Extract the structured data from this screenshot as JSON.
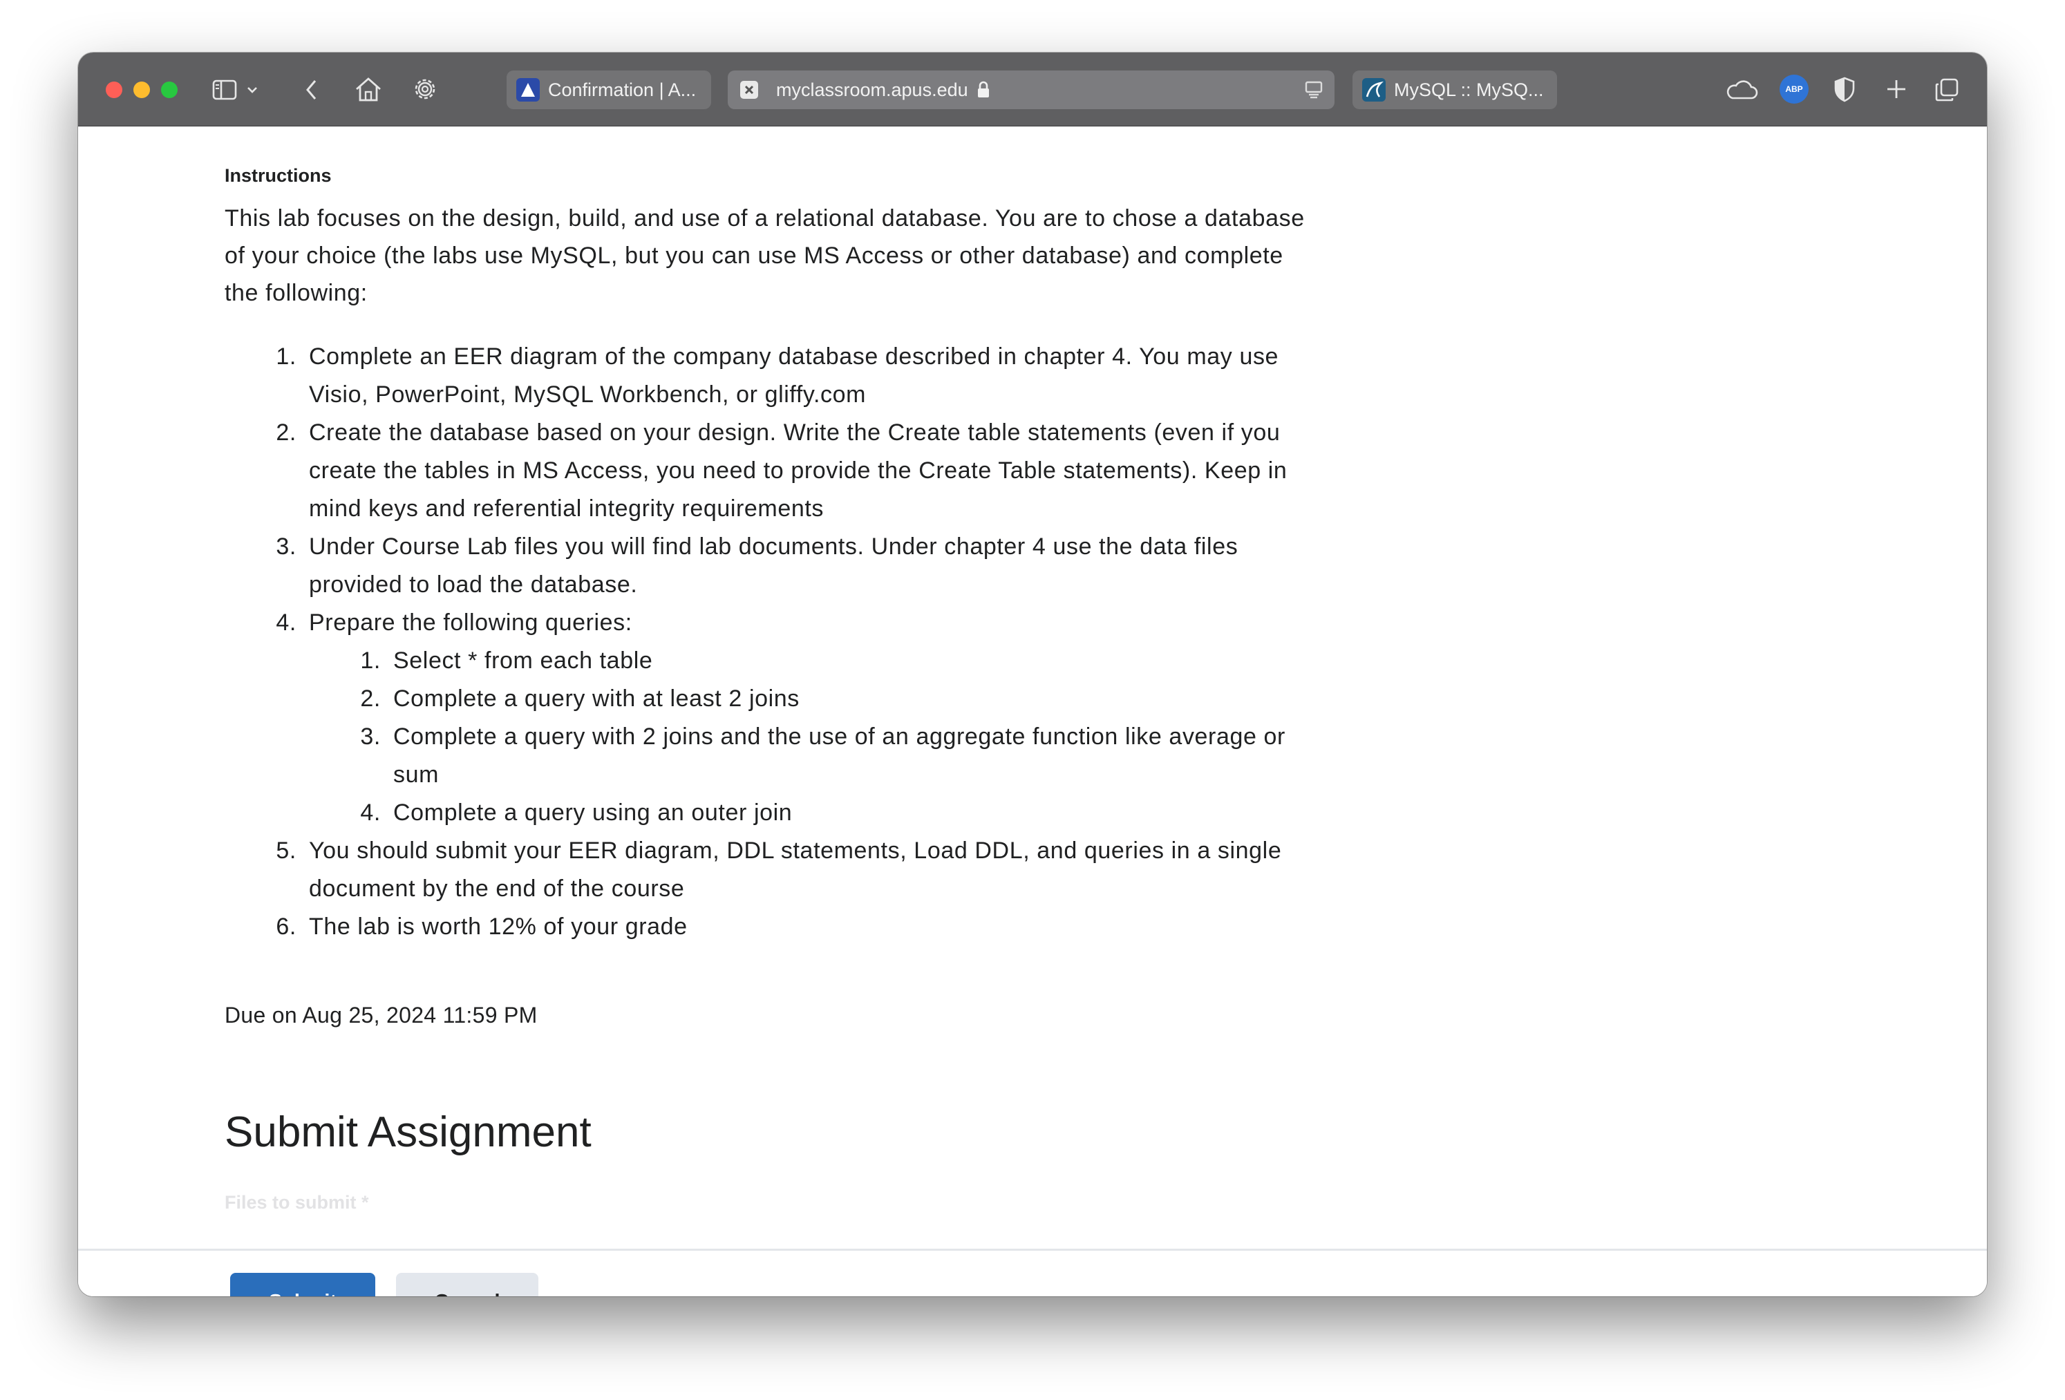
{
  "browser": {
    "tabs": [
      {
        "title": "Confirmation | A...",
        "favicon": "apus-icon",
        "active": false
      },
      {
        "title": "myclassroom.apus.edu",
        "favicon": "x-icon",
        "active": true,
        "lock": true
      },
      {
        "title": "MySQL :: MySQ...",
        "favicon": "mysql-icon",
        "active": false
      }
    ],
    "toolbar_icons": [
      "sidebar-icon",
      "chevron-down-icon",
      "back-icon",
      "home-icon",
      "gear-icon",
      "reader-icon",
      "cloud-icon",
      "abp-icon",
      "shield-icon",
      "plus-icon",
      "tabs-overview-icon"
    ],
    "abp_label": "ABP"
  },
  "assignment": {
    "instructions_label": "Instructions",
    "intro": "This lab focuses on the design, build, and use of a relational database. You are to chose a database of your choice (the labs use MySQL, but you can use MS Access or other database) and complete the following:",
    "steps": [
      "Complete an EER diagram of the company database described in chapter 4. You may use Visio, PowerPoint, MySQL Workbench, or gliffy.com",
      "Create the database based on your design. Write the Create table statements (even if you create the tables in MS Access, you need to provide the Create Table statements). Keep in mind keys and referential integrity requirements",
      "Under Course Lab files you will find lab documents. Under chapter 4 use the data files provided to load the database.",
      "Prepare the following queries:",
      "You should submit your EER diagram, DDL statements, Load DDL, and queries in a single document by the end of the course",
      "The lab is worth 12% of your grade"
    ],
    "queries": [
      "Select * from each table",
      "Complete a query with at least 2 joins",
      "Complete a query with 2 joins and the use of an aggregate function like average or sum",
      "Complete a query using an outer join"
    ],
    "due": "Due on Aug 25, 2024 11:59 PM",
    "submit_heading": "Submit Assignment",
    "files_label": "Files to submit *",
    "submit_button": "Submit",
    "cancel_button": "Cancel"
  },
  "colors": {
    "titlebar": "#5f5f61",
    "primary_button": "#2a6ebb",
    "secondary_button": "#e3e7ed",
    "text": "#202122"
  }
}
